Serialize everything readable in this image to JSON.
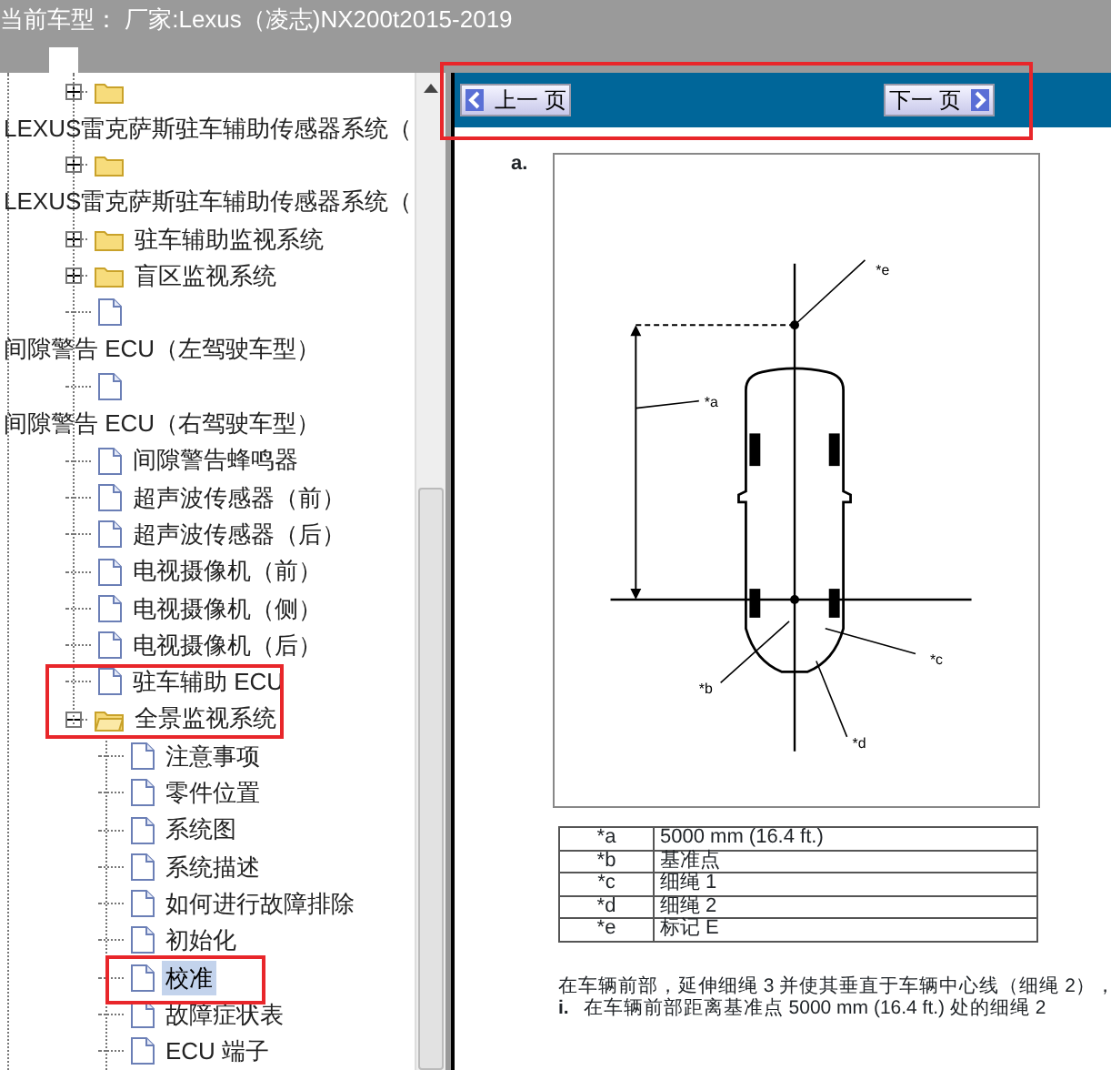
{
  "header": {
    "title": "当前车型： 厂家:Lexus（凌志)NX200t2015-2019"
  },
  "tree": {
    "items": [
      {
        "kind": "folder",
        "expanded": false
      },
      {
        "kind": "text",
        "label": "LEXUS雷克萨斯驻车辅助传感器系统（"
      },
      {
        "kind": "folder",
        "expanded": false
      },
      {
        "kind": "text",
        "label": "LEXUS雷克萨斯驻车辅助传感器系统（"
      },
      {
        "kind": "folder",
        "expanded": false,
        "label": "驻车辅助监视系统"
      },
      {
        "kind": "folder",
        "expanded": false,
        "label": "盲区监视系统"
      },
      {
        "kind": "page"
      },
      {
        "kind": "text",
        "label": "间隙警告 ECU（左驾驶车型）"
      },
      {
        "kind": "page"
      },
      {
        "kind": "text",
        "label": "间隙警告 ECU（右驾驶车型）"
      },
      {
        "kind": "page",
        "label": "间隙警告蜂鸣器",
        "selected": false
      },
      {
        "kind": "page",
        "label": "超声波传感器（前）",
        "selected": false
      },
      {
        "kind": "page",
        "label": "超声波传感器（后）",
        "selected": false
      },
      {
        "kind": "page",
        "label": "电视摄像机（前）",
        "selected": false
      },
      {
        "kind": "page",
        "label": "电视摄像机（侧）",
        "selected": false
      },
      {
        "kind": "page",
        "label": "电视摄像机（后）",
        "selected": false
      },
      {
        "kind": "page",
        "label": "驻车辅助 ECU",
        "selected": false
      },
      {
        "kind": "folder",
        "expanded": true,
        "label": "全景监视系统",
        "children": [
          {
            "kind": "page",
            "label": "注意事项",
            "selected": false
          },
          {
            "kind": "page",
            "label": "零件位置",
            "selected": false
          },
          {
            "kind": "page",
            "label": "系统图",
            "selected": false
          },
          {
            "kind": "page",
            "label": "系统描述",
            "selected": false
          },
          {
            "kind": "page",
            "label": "如何进行故障排除",
            "selected": false
          },
          {
            "kind": "page",
            "label": "初始化",
            "selected": false
          },
          {
            "kind": "page",
            "label": "校准",
            "selected": true
          },
          {
            "kind": "page",
            "label": "故障症状表",
            "selected": false
          },
          {
            "kind": "page",
            "label": "ECU 端子",
            "selected": false
          }
        ]
      }
    ]
  },
  "nav": {
    "buttons": [
      {
        "kind": "prev",
        "label": "上一 页"
      },
      {
        "kind": "next",
        "label": "下一 页"
      }
    ]
  },
  "document": {
    "step": "a.",
    "figure_labels": [
      "*e",
      "*a",
      "*b",
      "*c",
      "*d"
    ],
    "legend": [
      {
        "key": "*a",
        "value": "5000 mm (16.4 ft.)"
      },
      {
        "key": "*b",
        "value": "基准点"
      },
      {
        "key": "*c",
        "value": "细绳 1"
      },
      {
        "key": "*d",
        "value": "细绳 2"
      },
      {
        "key": "*e",
        "value": "标记 E"
      }
    ],
    "paragraphs": [
      {
        "text": "在车辆前部，延伸细绳 3 并使其垂直于车辆中心线（细绳 2），"
      },
      {
        "marker": "i.",
        "text": "在车辆前部距离基准点 5000 mm (16.4 ft.) 处的细绳 2"
      }
    ]
  }
}
